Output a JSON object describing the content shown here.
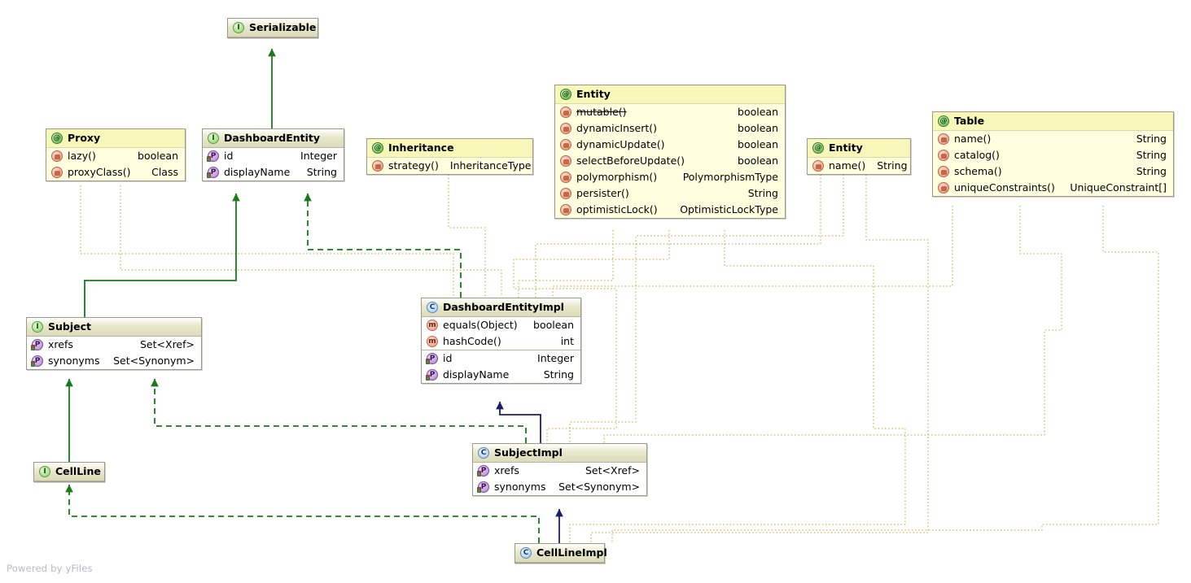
{
  "diagram": {
    "title": "UML Class Diagram",
    "watermark": "Powered by yFiles",
    "colors": {
      "background": "#ffffff",
      "node_border": "#9a9a86",
      "annotation_fill": "#ffffdf",
      "annotation_header": "#f7f7b9",
      "type_header_gradient_end": "#dcdcbb",
      "inheritance_edge": "#1a7a1a",
      "implements_edge": "#1a7a1a",
      "extends_class_edge": "#1d1d6e",
      "annotation_edge": "#b0a93a",
      "watermark_text": "#b9b9c4"
    }
  },
  "nodes": {
    "serializable": {
      "stereotype_icon": "interface-icon",
      "name": "Serializable",
      "kind": "interface",
      "members": []
    },
    "proxy": {
      "stereotype_icon": "annotation-icon",
      "name": "Proxy",
      "kind": "annotation",
      "members": [
        {
          "icon": "annotation-method-icon",
          "name": "lazy()",
          "type": "boolean",
          "deprecated": false
        },
        {
          "icon": "annotation-method-icon",
          "name": "proxyClass()",
          "type": "Class",
          "deprecated": false
        }
      ]
    },
    "dashboard_entity": {
      "stereotype_icon": "interface-icon",
      "name": "DashboardEntity",
      "kind": "interface",
      "members": [
        {
          "icon": "property-icon",
          "name": "id",
          "type": "Integer",
          "deprecated": false
        },
        {
          "icon": "property-icon",
          "name": "displayName",
          "type": "String",
          "deprecated": false
        }
      ]
    },
    "inheritance": {
      "stereotype_icon": "annotation-icon",
      "name": "Inheritance",
      "kind": "annotation",
      "members": [
        {
          "icon": "annotation-method-icon",
          "name": "strategy()",
          "type": "InheritanceType",
          "deprecated": false
        }
      ]
    },
    "entity_hibernate": {
      "stereotype_icon": "annotation-icon",
      "name": "Entity",
      "kind": "annotation",
      "members": [
        {
          "icon": "annotation-method-icon",
          "name": "mutable()",
          "type": "boolean",
          "deprecated": true
        },
        {
          "icon": "annotation-method-icon",
          "name": "dynamicInsert()",
          "type": "boolean",
          "deprecated": false
        },
        {
          "icon": "annotation-method-icon",
          "name": "dynamicUpdate()",
          "type": "boolean",
          "deprecated": false
        },
        {
          "icon": "annotation-method-icon",
          "name": "selectBeforeUpdate()",
          "type": "boolean",
          "deprecated": false
        },
        {
          "icon": "annotation-method-icon",
          "name": "polymorphism()",
          "type": "PolymorphismType",
          "deprecated": false
        },
        {
          "icon": "annotation-method-icon",
          "name": "persister()",
          "type": "String",
          "deprecated": false
        },
        {
          "icon": "annotation-method-icon",
          "name": "optimisticLock()",
          "type": "OptimisticLockType",
          "deprecated": false
        }
      ]
    },
    "entity_jpa": {
      "stereotype_icon": "annotation-icon",
      "name": "Entity",
      "kind": "annotation",
      "members": [
        {
          "icon": "annotation-method-icon",
          "name": "name()",
          "type": "String",
          "deprecated": false
        }
      ]
    },
    "table": {
      "stereotype_icon": "annotation-icon",
      "name": "Table",
      "kind": "annotation",
      "members": [
        {
          "icon": "annotation-method-icon",
          "name": "name()",
          "type": "String",
          "deprecated": false
        },
        {
          "icon": "annotation-method-icon",
          "name": "catalog()",
          "type": "String",
          "deprecated": false
        },
        {
          "icon": "annotation-method-icon",
          "name": "schema()",
          "type": "String",
          "deprecated": false
        },
        {
          "icon": "annotation-method-icon",
          "name": "uniqueConstraints()",
          "type": "UniqueConstraint[]",
          "deprecated": false
        }
      ]
    },
    "subject": {
      "stereotype_icon": "interface-icon",
      "name": "Subject",
      "kind": "interface",
      "members": [
        {
          "icon": "property-icon",
          "name": "xrefs",
          "type": "Set<Xref>",
          "deprecated": false
        },
        {
          "icon": "property-icon",
          "name": "synonyms",
          "type": "Set<Synonym>",
          "deprecated": false
        }
      ]
    },
    "dashboard_entity_impl": {
      "stereotype_icon": "class-icon",
      "name": "DashboardEntityImpl",
      "kind": "class",
      "methods": [
        {
          "icon": "method-icon",
          "name": "equals(Object)",
          "type": "boolean",
          "deprecated": false
        },
        {
          "icon": "method-icon",
          "name": "hashCode()",
          "type": "int",
          "deprecated": false
        }
      ],
      "properties": [
        {
          "icon": "property-icon",
          "name": "id",
          "type": "Integer",
          "deprecated": false
        },
        {
          "icon": "property-icon",
          "name": "displayName",
          "type": "String",
          "deprecated": false
        }
      ]
    },
    "cell_line": {
      "stereotype_icon": "interface-icon",
      "name": "CellLine",
      "kind": "interface",
      "members": []
    },
    "subject_impl": {
      "stereotype_icon": "class-icon",
      "name": "SubjectImpl",
      "kind": "class",
      "members": [
        {
          "icon": "property-icon",
          "name": "xrefs",
          "type": "Set<Xref>",
          "deprecated": false
        },
        {
          "icon": "property-icon",
          "name": "synonyms",
          "type": "Set<Synonym>",
          "deprecated": false
        }
      ]
    },
    "cell_line_impl": {
      "stereotype_icon": "class-icon",
      "name": "CellLineImpl",
      "kind": "class",
      "members": []
    }
  },
  "icon_glyphs": {
    "annotation-icon": "@",
    "interface-icon": "I",
    "class-icon": "C",
    "method-icon": "m",
    "property-icon": "P",
    "annotation-method-icon": ""
  }
}
